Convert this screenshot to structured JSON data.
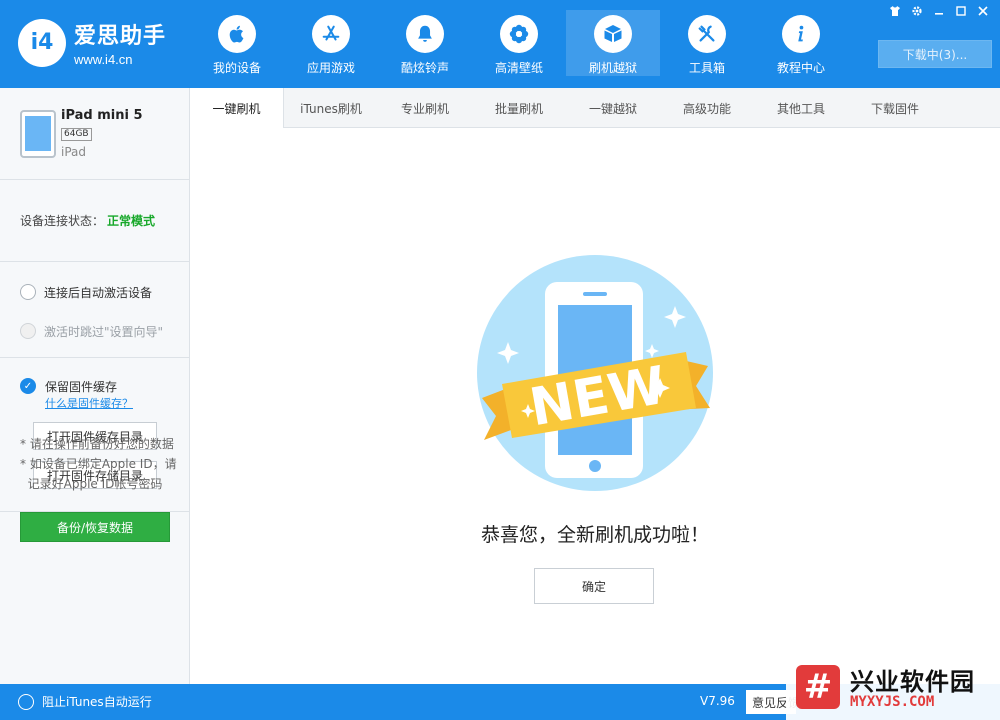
{
  "app": {
    "logo_badge": "i4",
    "name": "爱思助手",
    "url": "www.i4.cn"
  },
  "nav": [
    {
      "label": "我的设备",
      "icon": "apple-icon"
    },
    {
      "label": "应用游戏",
      "icon": "app-store-icon"
    },
    {
      "label": "酷炫铃声",
      "icon": "bell-icon"
    },
    {
      "label": "高清壁纸",
      "icon": "flower-icon"
    },
    {
      "label": "刷机越狱",
      "icon": "box-icon"
    },
    {
      "label": "工具箱",
      "icon": "tools-icon"
    },
    {
      "label": "教程中心",
      "icon": "info-icon"
    }
  ],
  "download_button": "下载中(3)...",
  "window_controls": [
    "shirt-icon",
    "gear-icon",
    "minimize-icon",
    "maximize-icon",
    "close-icon"
  ],
  "device": {
    "name": "iPad mini 5",
    "capacity": "64GB",
    "type": "iPad"
  },
  "connection": {
    "label": "设备连接状态：",
    "value": "正常模式"
  },
  "options": [
    {
      "label": "连接后自动激活设备",
      "disabled": false
    },
    {
      "label": "激活时跳过\"设置向导\"",
      "disabled": true
    }
  ],
  "cache": {
    "label": "保留固件缓存",
    "link": "什么是固件缓存？",
    "open_cache_dir": "打开固件缓存目录",
    "open_storage_dir": "打开固件存储目录"
  },
  "notes": [
    "* 请在操作前备份好您的数据",
    "* 如设备已绑定Apple ID，请",
    "  记录好Apple ID帐号密码"
  ],
  "backup_button": "备份/恢复数据",
  "tabs": [
    "一键刷机",
    "iTunes刷机",
    "专业刷机",
    "批量刷机",
    "一键越狱",
    "高级功能",
    "其他工具",
    "下载固件"
  ],
  "main": {
    "badge_text": "NEW",
    "success_message": "恭喜您，全新刷机成功啦！",
    "confirm_button": "确定"
  },
  "footer": {
    "itunes_toggle": "阻止iTunes自动运行",
    "version": "V7.96",
    "feedback": "意见反馈"
  },
  "watermark": {
    "glyph": "#",
    "name": "兴业软件园",
    "url": "MYXYJS.COM"
  },
  "colors": {
    "primary": "#1b8ae8",
    "status_green": "#18a82a",
    "backup_green": "#2fae43",
    "ribbon_yellow": "#f9c83a"
  }
}
